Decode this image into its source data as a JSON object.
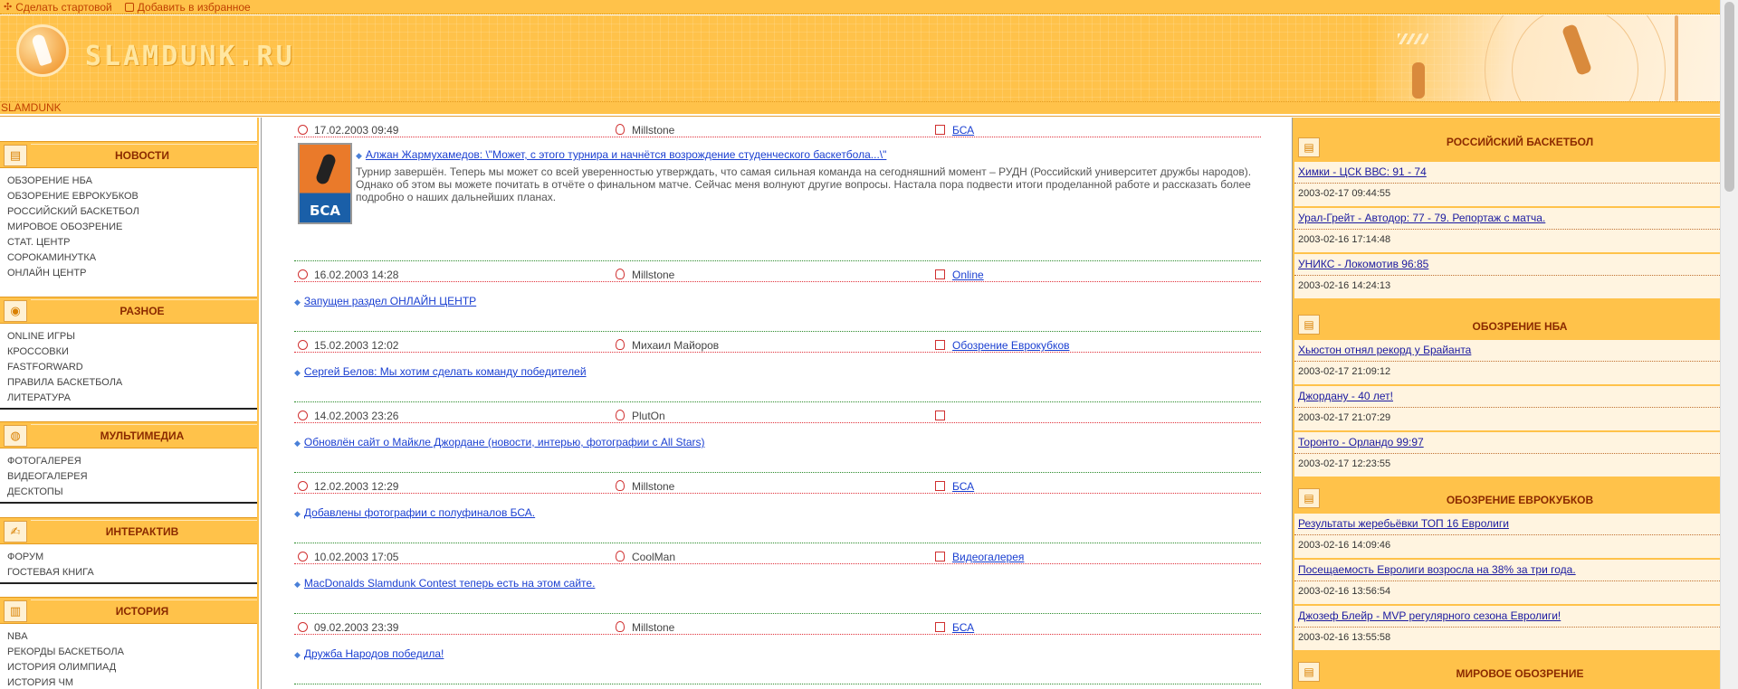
{
  "topbar": {
    "make_home": "Сделать стартовой",
    "add_favorite": "Добавить в избранное"
  },
  "header": {
    "logo_text": "SLAMDUNK.RU",
    "brand": "SLAMDUNK"
  },
  "left_menu": [
    {
      "title": "НОВОСТИ",
      "icon": "newspaper-icon",
      "items": [
        "ОБЗОРЕНИЕ НБА",
        "ОБЗОРЕНИЕ ЕВРОКУБКОВ",
        "РОССИЙСКИЙ БАСКЕТБОЛ",
        "МИРОВОЕ ОБОЗРЕНИЕ",
        "СТАТ. ЦЕНТР",
        "СОРОКАМИНУТКА",
        "ОНЛАЙН ЦЕНТР"
      ]
    },
    {
      "title": "РАЗНОЕ",
      "icon": "ball-icon",
      "items": [
        "ONLINE ИГРЫ",
        "КРОССОВКИ",
        "FASTFORWARD",
        "ПРАВИЛА БАСКЕТБОЛА",
        "ЛИТЕРАТУРА"
      ]
    },
    {
      "title": "МУЛЬТИМЕДИА",
      "icon": "media-icon",
      "items": [
        "ФОТОГАЛЕРЕЯ",
        "ВИДЕОГАЛЕРЕЯ",
        "ДЕСКТОПЫ"
      ]
    },
    {
      "title": "ИНТЕРАКТИВ",
      "icon": "chat-icon",
      "items": [
        "ФОРУМ",
        "ГОСТЕВАЯ КНИГА"
      ]
    },
    {
      "title": "ИСТОРИЯ",
      "icon": "book-icon",
      "items": [
        "NBA",
        "РЕКОРДЫ БАСКЕТБОЛА",
        "ИСТОРИЯ ОЛИМПИАД",
        "ИСТОРИЯ ЧМ"
      ]
    }
  ],
  "news": [
    {
      "date": "17.02.2003 09:49",
      "author": "Millstone",
      "category": "БСА",
      "title": "Алжан Жармухамедов: \\\"Может, с этого турнира и начнётся возрождение студенческого баскетбола...\\\"",
      "text": "Турнир завершён. Теперь мы может со всей уверенностью утверждать, что самая сильная команда на сегодняшний момент – РУДН (Российский университет дружбы народов). Однако об этом вы можете почитать в отчёте о финальном матче. Сейчас меня волнуют другие вопросы. Настала пора подвести итоги проделанной работе и рассказать более подробно о наших дальнейших планах.",
      "logo": "БСА"
    },
    {
      "date": "16.02.2003 14:28",
      "author": "Millstone",
      "category": "Online",
      "title": "Запущен раздел ОНЛАЙН ЦЕНТР"
    },
    {
      "date": "15.02.2003 12:02",
      "author": "Михаил Майоров",
      "category": "Обозрение Еврокубков",
      "title": "Сергей Белов: Мы хотим сделать команду победителей"
    },
    {
      "date": "14.02.2003 23:26",
      "author": "PlutOn",
      "category": "",
      "title": "Обновлён сайт о Майкле Джордане (новости, интерью, фотографии с All Stars)"
    },
    {
      "date": "12.02.2003 12:29",
      "author": "Millstone",
      "category": "БСА",
      "title": "Добавлены фотографии с полуфиналов БСА."
    },
    {
      "date": "10.02.2003 17:05",
      "author": "CoolMan",
      "category": "Видеогалерея",
      "title": "MacDonalds Slamdunk Contest теперь есть на этом сайте."
    },
    {
      "date": "09.02.2003 23:39",
      "author": "Millstone",
      "category": "БСА",
      "title": "Дружба Народов победила!"
    }
  ],
  "right_sections": [
    {
      "title": "РОССИЙСКИЙ БАСКЕТБОЛ",
      "items": [
        {
          "link": "Химки - ЦСК ВВС: 91 - 74",
          "date": "2003-02-17 09:44:55"
        },
        {
          "link": "Урал-Грейт - Автодор: 77 - 79. Репортаж с матча.",
          "date": "2003-02-16 17:14:48"
        },
        {
          "link": "УНИКС - Локомотив 96:85",
          "date": "2003-02-16 14:24:13"
        }
      ]
    },
    {
      "title": "ОБОЗРЕНИЕ НБА",
      "items": [
        {
          "link": "Хьюстон отнял рекорд у Брайанта",
          "date": "2003-02-17 21:09:12"
        },
        {
          "link": "Джордану - 40 лет!",
          "date": "2003-02-17 21:07:29"
        },
        {
          "link": "Торонто - Орландо 99:97",
          "date": "2003-02-17 12:23:55"
        }
      ]
    },
    {
      "title": "ОБОЗРЕНИЕ ЕВРОКУБКОВ",
      "items": [
        {
          "link": "Результаты жеребьёвки ТОП 16 Евролиги",
          "date": "2003-02-16 14:09:46"
        },
        {
          "link": "Посещаемость Евролиги возросла на 38% за три года.",
          "date": "2003-02-16 13:56:54"
        },
        {
          "link": "Джозеф Блейр - MVP регулярного сезона Евролиги!",
          "date": "2003-02-16 13:55:58"
        }
      ]
    },
    {
      "title": "МИРОВОЕ ОБОЗРЕНИЕ",
      "items": []
    }
  ]
}
